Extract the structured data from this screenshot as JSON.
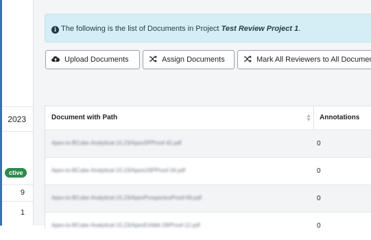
{
  "left_panel": {
    "year": "2023",
    "status_badge": "ctive",
    "count_a": "9",
    "count_b": "1"
  },
  "alert": {
    "text": "The following is the list of Documents in Project",
    "project_name": "Test Review Project 1",
    "suffix": "."
  },
  "toolbar": {
    "upload_label": "Upload Documents",
    "assign_label": "Assign Documents",
    "mark_label": "Mark All Reviewers to All Documents"
  },
  "table": {
    "headers": {
      "document": "Document with Path",
      "annotations": "Annotations"
    },
    "rows": [
      {
        "document": "Apex-to-BCube-Analytical-15.23/ApexSPProof-42.pdf",
        "annotations": "0"
      },
      {
        "document": "Apex-to-BCube-Analytical-15.23/ApexUSPProof-34.pdf",
        "annotations": "0"
      },
      {
        "document": "Apex-to-BCube-Analytical-15.23/ApexProspectusProof-66.pdf",
        "annotations": "0"
      },
      {
        "document": "Apex-to-BCube-Analytical-15.23/ApexExhibit-28/Proof-12.pdf",
        "annotations": "0"
      }
    ]
  },
  "colors": {
    "alert_bg": "#d5eef5",
    "badge_green": "#2e8b4e",
    "accent_blue": "#3a6fb5"
  },
  "icons": {
    "info": "info-circle-icon",
    "upload": "cloud-upload-icon",
    "assign": "shuffle-icon",
    "mark": "shuffle-icon",
    "sort": "sort-icon"
  }
}
